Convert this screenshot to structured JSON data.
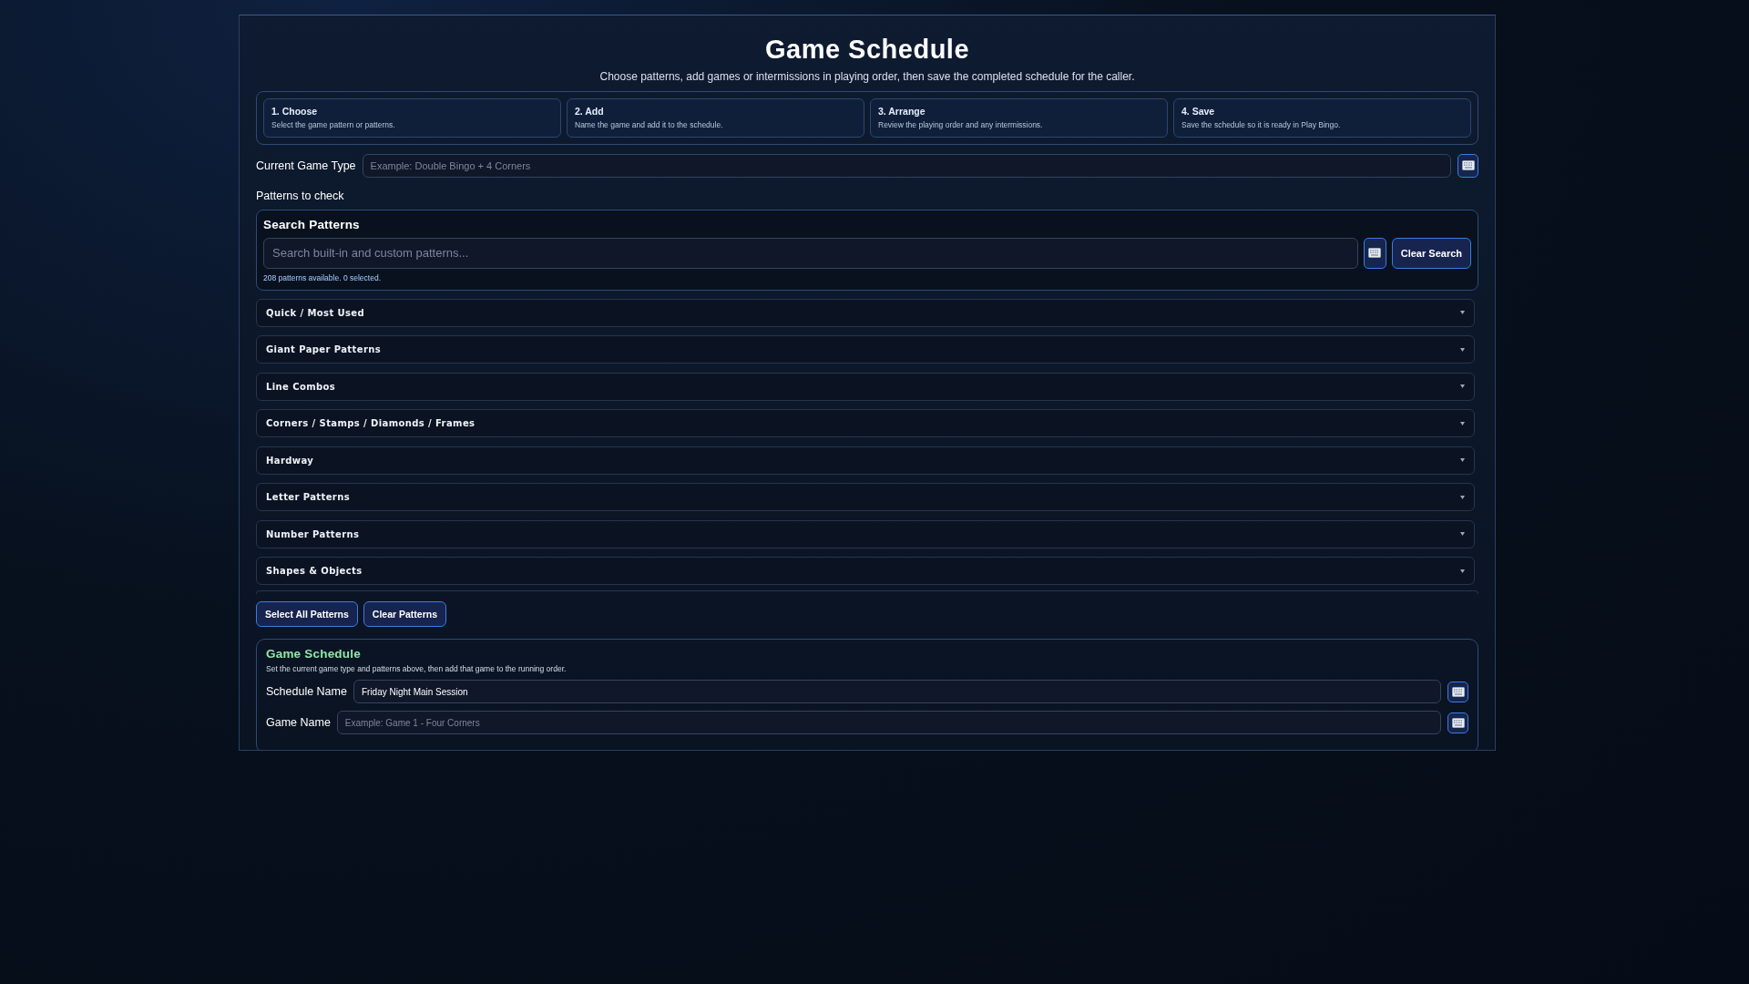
{
  "title": "Game Schedule",
  "subtitle": "Choose patterns, add games or intermissions in playing order, then save the completed schedule for the caller.",
  "steps": [
    {
      "title": "1. Choose",
      "text": "Select the game pattern or patterns."
    },
    {
      "title": "2. Add",
      "text": "Name the game and add it to the schedule."
    },
    {
      "title": "3. Arrange",
      "text": "Review the playing order and any intermissions."
    },
    {
      "title": "4. Save",
      "text": "Save the schedule so it is ready in Play Bingo."
    }
  ],
  "current_game_type": {
    "label": "Current Game Type",
    "placeholder": "Example: Double Bingo + 4 Corners"
  },
  "patterns_label": "Patterns to check",
  "search": {
    "heading": "Search Patterns",
    "placeholder": "Search built-in and custom patterns...",
    "clear_button": "Clear Search",
    "status": "208 patterns available. 0 selected."
  },
  "categories": [
    {
      "label": "Quick / Most Used"
    },
    {
      "label": "Giant Paper Patterns"
    },
    {
      "label": "Line Combos"
    },
    {
      "label": "Corners / Stamps / Diamonds / Frames"
    },
    {
      "label": "Hardway"
    },
    {
      "label": "Letter Patterns"
    },
    {
      "label": "Number Patterns"
    },
    {
      "label": "Shapes & Objects"
    }
  ],
  "pattern_buttons": [
    "Select All Patterns",
    "Clear Patterns"
  ],
  "schedule": {
    "heading": "Game Schedule",
    "help": "Set the current game type and patterns above, then add that game to the running order.",
    "fields": [
      {
        "label": "Schedule Name",
        "value": "Friday Night Main Session"
      },
      {
        "label": "Game Name",
        "placeholder": "Example: Game 1 - Four Corners"
      }
    ]
  }
}
